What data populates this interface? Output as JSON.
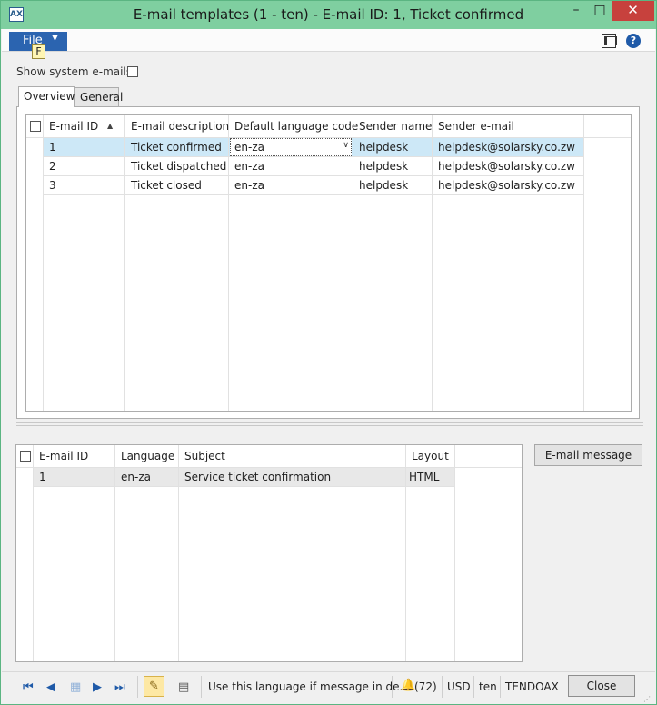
{
  "window": {
    "title": "E-mail templates (1 - ten) - E-mail ID: 1, Ticket confirmed",
    "minimize": "–",
    "maximize": "□",
    "close": "✕"
  },
  "menu": {
    "file_label": "File",
    "keytip": "F"
  },
  "filters": {
    "show_system_label": "Show system e-mails:",
    "show_system_checked": false
  },
  "tabs": [
    {
      "label": "Overview",
      "active": true
    },
    {
      "label": "General",
      "active": false
    }
  ],
  "templates_grid": {
    "columns": [
      "E-mail ID",
      "E-mail description",
      "Default language code",
      "Sender name",
      "Sender e-mail"
    ],
    "rows": [
      {
        "id": "1",
        "description": "Ticket confirmed",
        "language": "en-za",
        "sender_name": "helpdesk",
        "sender_email": "helpdesk@solarsky.co.zw"
      },
      {
        "id": "2",
        "description": "Ticket dispatched",
        "language": "en-za",
        "sender_name": "helpdesk",
        "sender_email": "helpdesk@solarsky.co.zw"
      },
      {
        "id": "3",
        "description": "Ticket closed",
        "language": "en-za",
        "sender_name": "helpdesk",
        "sender_email": "helpdesk@solarsky.co.zw"
      }
    ]
  },
  "messages_grid": {
    "columns": [
      "E-mail ID",
      "Language",
      "Subject",
      "Layout"
    ],
    "rows": [
      {
        "id": "1",
        "language": "en-za",
        "subject": "Service ticket confirmation",
        "layout": "HTML"
      }
    ]
  },
  "buttons": {
    "email_message": "E-mail message",
    "close": "Close"
  },
  "statusbar": {
    "help_text": "Use this language if message in de...",
    "notifications": "(72)",
    "currency": "USD",
    "company": "ten",
    "server": "TENDOAX"
  },
  "colors": {
    "titlebar": "#7fcfa0",
    "file_button": "#2b64b0",
    "selected_row": "#cde8f7",
    "close_button": "#c7413d"
  }
}
